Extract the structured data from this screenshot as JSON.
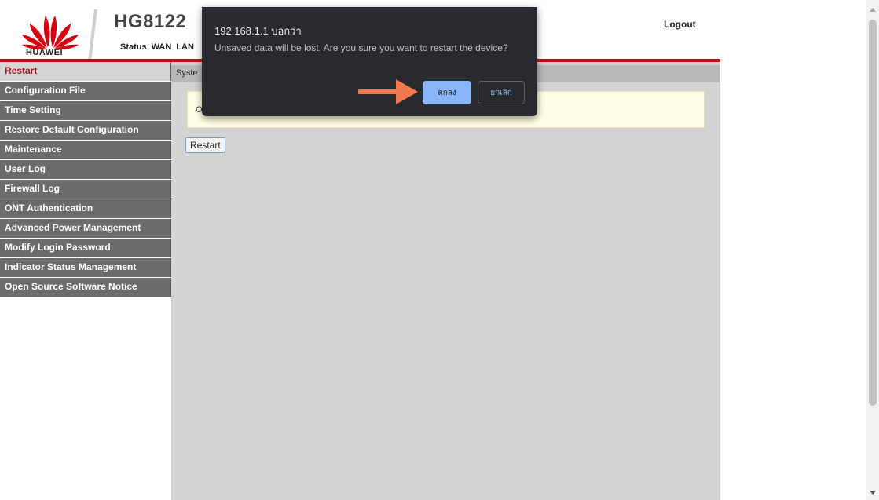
{
  "header": {
    "brand": "HUAWEI",
    "model": "HG8122",
    "nav": [
      "Status",
      "WAN",
      "LAN"
    ],
    "logout": "Logout"
  },
  "sidebar": {
    "items": [
      {
        "label": "Restart",
        "active": true
      },
      {
        "label": "Configuration File"
      },
      {
        "label": "Time Setting"
      },
      {
        "label": "Restore Default Configuration"
      },
      {
        "label": "Maintenance"
      },
      {
        "label": "User Log"
      },
      {
        "label": "Firewall Log"
      },
      {
        "label": "ONT Authentication"
      },
      {
        "label": "Advanced Power Management"
      },
      {
        "label": "Modify Login Password"
      },
      {
        "label": "Indicator Status Management"
      },
      {
        "label": "Open Source Software Notice"
      }
    ]
  },
  "content": {
    "breadcrumb": "Syste",
    "notice": "O",
    "restart_button": "Restart"
  },
  "dialog": {
    "title": "192.168.1.1 บอกว่า",
    "message": "Unsaved data will be lost. Are you sure you want to restart the device?",
    "ok": "ตกลง",
    "cancel": "ยกเลิก"
  },
  "colors": {
    "brand_red": "#b5141a",
    "sidebar_bg": "#6b6b6b",
    "dialog_bg": "#292a2d",
    "ok_button": "#8ab4f8",
    "arrow": "#f07a4f"
  },
  "icons": {
    "logo": "huawei-flower-logo",
    "arrow": "right-arrow-annotation",
    "scroll_up": "chevron-up-icon",
    "scroll_down": "chevron-down-icon"
  }
}
